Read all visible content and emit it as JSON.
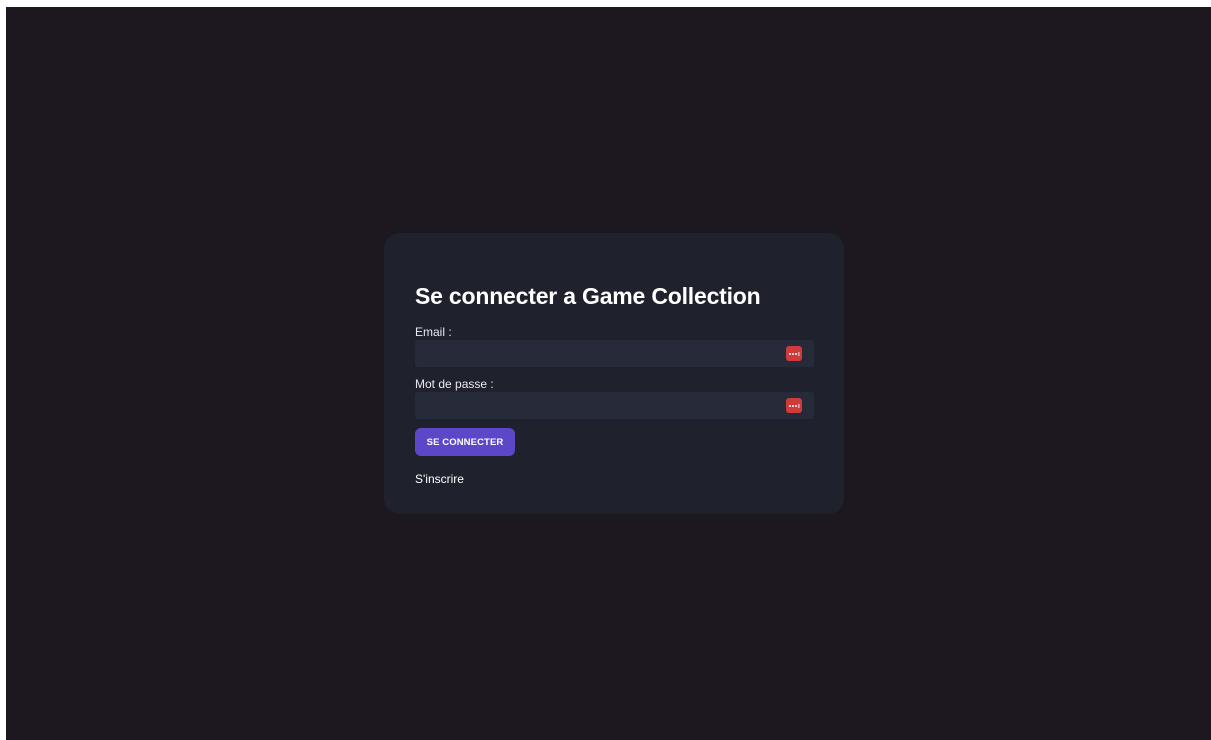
{
  "page": {
    "background_color": "#1d1820",
    "card_color": "#1f222d"
  },
  "login": {
    "title": "Se connecter a Game Collection",
    "email": {
      "label": "Email :",
      "value": "",
      "icon": "password-manager-icon"
    },
    "password": {
      "label": "Mot de passe :",
      "value": "",
      "icon": "password-manager-icon"
    },
    "submit_label": "SE CONNECTER",
    "submit_color": "#5b47c8",
    "register_link": "S'inscrire"
  }
}
